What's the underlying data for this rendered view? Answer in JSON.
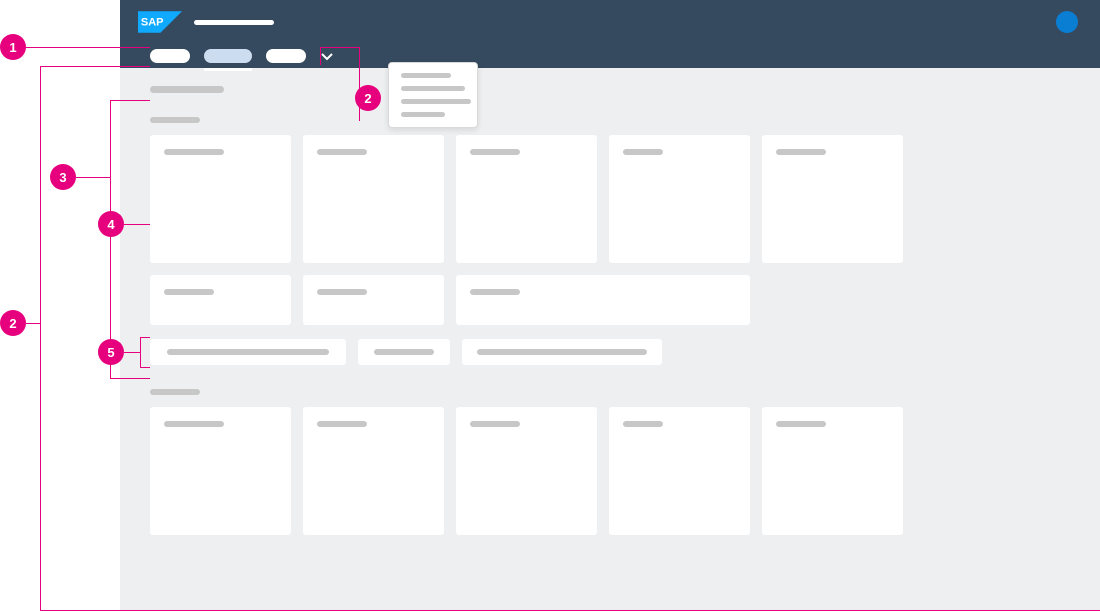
{
  "annotations": {
    "left": [
      {
        "id": "1",
        "label": "1"
      },
      {
        "id": "2",
        "label": "2"
      },
      {
        "id": "3",
        "label": "3"
      },
      {
        "id": "4",
        "label": "4"
      },
      {
        "id": "5",
        "label": "5"
      }
    ],
    "right": [
      {
        "id": "r2",
        "label": "2"
      }
    ]
  },
  "shell": {
    "logo": "SAP",
    "app_title": "",
    "user": ""
  },
  "nav": {
    "tabs": [
      {
        "label": "",
        "state": "inactive"
      },
      {
        "label": "",
        "state": "active"
      },
      {
        "label": "",
        "state": "inactive"
      }
    ],
    "more_icon": "chevron-down"
  },
  "dropdown": {
    "items": [
      "",
      "",
      "",
      ""
    ]
  },
  "page": {
    "title": "",
    "sections": [
      {
        "title": "",
        "tile_rows": [
          {
            "tiles": [
              {
                "label": "",
                "size": "large"
              },
              {
                "label": "",
                "size": "large"
              },
              {
                "label": "",
                "size": "large"
              },
              {
                "label": "",
                "size": "large"
              },
              {
                "label": "",
                "size": "large"
              }
            ]
          },
          {
            "tiles": [
              {
                "label": "",
                "size": "small"
              },
              {
                "label": "",
                "size": "small"
              },
              {
                "label": "",
                "size": "wide"
              }
            ]
          }
        ],
        "links": [
          {
            "label": ""
          },
          {
            "label": ""
          },
          {
            "label": ""
          }
        ]
      },
      {
        "title": "",
        "tile_rows": [
          {
            "tiles": [
              {
                "label": "",
                "size": "large"
              },
              {
                "label": "",
                "size": "large"
              },
              {
                "label": "",
                "size": "large"
              },
              {
                "label": "",
                "size": "large"
              },
              {
                "label": "",
                "size": "large"
              }
            ]
          }
        ]
      }
    ]
  },
  "colors": {
    "shell_bg": "#354a5f",
    "page_bg": "#edeff0",
    "tile_bg": "#ffffff",
    "placeholder": "#c7c7c7",
    "accent": "#0a7ed3",
    "annotation": "#e6007e",
    "active_tab": "#cdddf0"
  }
}
